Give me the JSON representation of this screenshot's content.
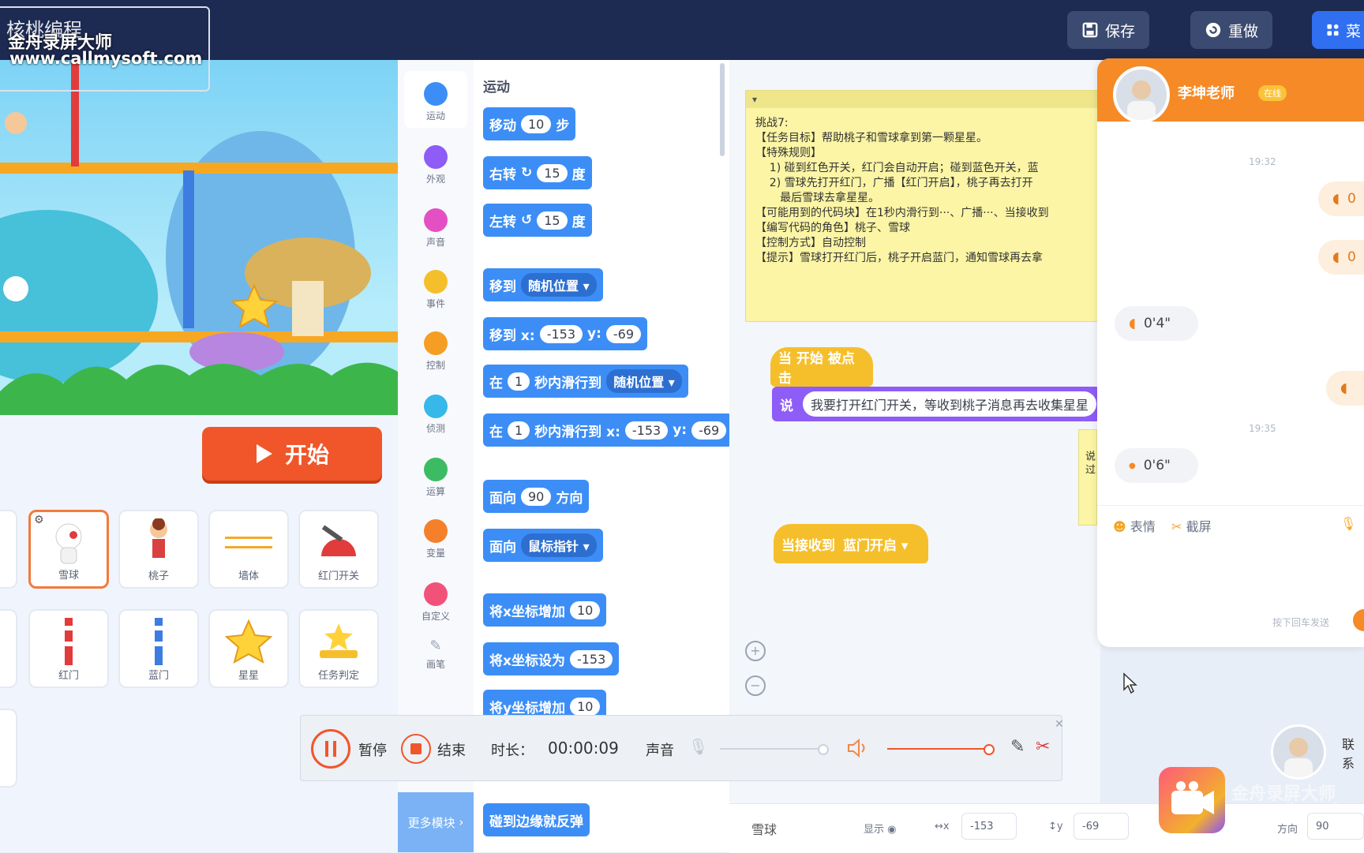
{
  "app": {
    "brand": "核桃编程",
    "watermark_name": "金舟录屏大师",
    "watermark_url": "www.callmysoft.com"
  },
  "toolbar": {
    "save_label": "保存",
    "redo_label": "重做",
    "menu_label": "菜"
  },
  "stage": {
    "start_label": "开始"
  },
  "sprites": [
    {
      "label": "雪球",
      "selected": true
    },
    {
      "label": "桃子"
    },
    {
      "label": "墙体"
    },
    {
      "label": "红门开关"
    },
    {
      "label": "红门"
    },
    {
      "label": "蓝门"
    },
    {
      "label": "星星"
    },
    {
      "label": "任务判定"
    }
  ],
  "categories": [
    {
      "label": "运动",
      "color": "#3c8ef6"
    },
    {
      "label": "外观",
      "color": "#8e5cf6"
    },
    {
      "label": "声音",
      "color": "#e54fc4"
    },
    {
      "label": "事件",
      "color": "#f5bf2c"
    },
    {
      "label": "控制",
      "color": "#f59e23"
    },
    {
      "label": "侦测",
      "color": "#36b8e8"
    },
    {
      "label": "运算",
      "color": "#3dbb62"
    },
    {
      "label": "变量",
      "color": "#f5802c"
    },
    {
      "label": "自定义",
      "color": "#f2527a"
    },
    {
      "label": "画笔",
      "color": "#9aa3b3"
    }
  ],
  "more_blocks_label": "更多模块",
  "palette": {
    "title": "运动",
    "move": {
      "a": "移动",
      "n": "10",
      "b": "步"
    },
    "turn_right": {
      "a": "右转",
      "n": "15",
      "b": "度"
    },
    "turn_left": {
      "a": "左转",
      "n": "15",
      "b": "度"
    },
    "goto": {
      "a": "移到",
      "dd": "随机位置"
    },
    "goto_xy": {
      "a": "移到 x:",
      "x": "-153",
      "ylab": "y:",
      "y": "-69"
    },
    "glide": {
      "a": "在",
      "n": "1",
      "b": "秒内滑行到",
      "dd": "随机位置"
    },
    "glide_xy": {
      "a": "在",
      "n": "1",
      "b": "秒内滑行到 x:",
      "x": "-153",
      "ylab": "y:",
      "y": "-69"
    },
    "point_dir": {
      "a": "面向",
      "n": "90",
      "b": "方向"
    },
    "point_to": {
      "a": "面向",
      "dd": "鼠标指针"
    },
    "change_x": {
      "a": "将x坐标增加",
      "n": "10"
    },
    "set_x": {
      "a": "将x坐标设为",
      "n": "-153"
    },
    "change_y": {
      "a": "将y坐标增加",
      "n": "10"
    },
    "bounce": {
      "a": "碰到边缘就反弹"
    }
  },
  "note": {
    "text": "挑战7:\n【任务目标】帮助桃子和雪球拿到第一颗星星。\n【特殊规则】\n    1) 碰到红色开关，红门会自动开启；碰到蓝色开关，蓝\n    2) 雪球先打开红门，广播【红门开启】，桃子再去打开\n       最后雪球去拿星星。\n【可能用到的代码块】在1秒内滑行到···、广播···、当接收到\n【编写代码的角色】桃子、雪球\n【控制方式】自动控制\n【提示】雪球打开红门后，桃子开启蓝门，通知雪球再去拿"
  },
  "script": {
    "when_flag": "当 开始 被点击",
    "say_label": "说",
    "say_text": "我要打开红门开关，等收到桃子消息再去收集星星",
    "when_receive": "当接收到",
    "receive_msg": "蓝门开启"
  },
  "side_note": "说 过",
  "sprite_info": {
    "name": "雪球",
    "show_label": "显示",
    "x_label": "x",
    "x": "-153",
    "y_label": "y",
    "y": "-69",
    "dir_label": "方向",
    "dir": "90"
  },
  "chat": {
    "teacher": "李坤老师",
    "status": "在线",
    "ts1": "19:32",
    "ts2": "19:35",
    "messages": [
      {
        "text": "0",
        "me": true
      },
      {
        "text": "0",
        "me": true
      },
      {
        "text": "0'4\"",
        "me": false
      },
      {
        "text": "",
        "me": true
      },
      {
        "text": "0'6\"",
        "me": false
      }
    ],
    "emoji_label": "表情",
    "screenshot_label": "截屏",
    "hint": "按下回车发送"
  },
  "recorder": {
    "pause_label": "暂停",
    "stop_label": "结束",
    "duration_label": "时长：",
    "duration": "00:00:09",
    "sound_label": "声音"
  },
  "contact_label": "联系",
  "recorder_brand": "金舟录屏大师",
  "recorder_brand_url": "www.callmysoft.com"
}
